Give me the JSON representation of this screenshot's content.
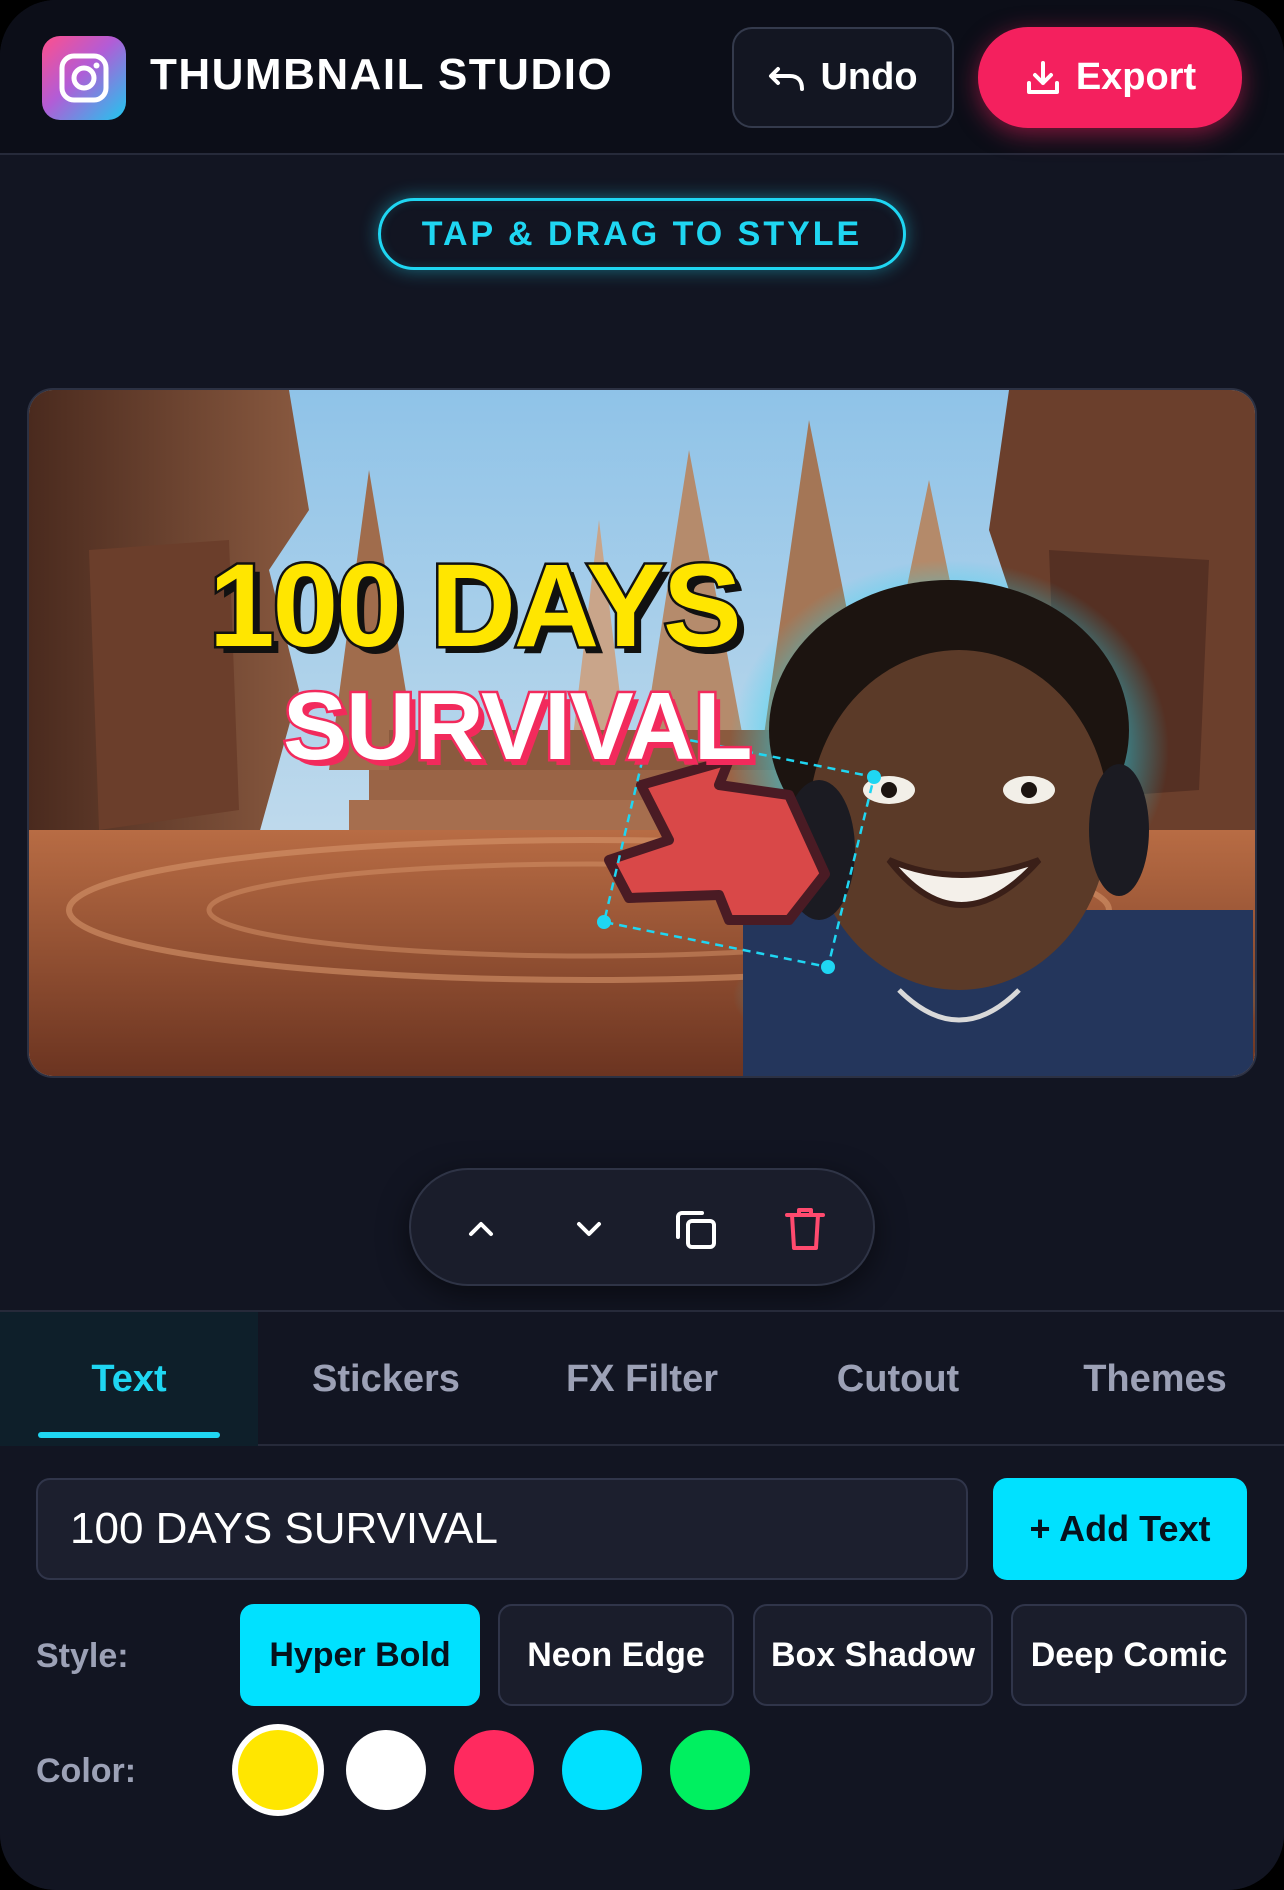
{
  "header": {
    "app_icon": "camera-icon",
    "title": "THUMBNAIL STUDIO",
    "undo_label": "Undo",
    "export_label": "Export"
  },
  "hint": {
    "label": "TAP & DRAG TO STYLE"
  },
  "canvas": {
    "headline": "100 DAYS",
    "headline_color": "#ffe600",
    "subline": "SURVIVAL",
    "subline_outline_color": "#f22a5c",
    "sticker": "arrow-sticker",
    "background": "canyon-arena",
    "cutout": "excited-person-with-headphones"
  },
  "layer_toolbar": {
    "buttons": [
      "chevron-up-icon",
      "chevron-down-icon",
      "duplicate-icon",
      "trash-icon"
    ]
  },
  "tabs": [
    {
      "label": "Text",
      "active": true
    },
    {
      "label": "Stickers",
      "active": false
    },
    {
      "label": "FX Filter",
      "active": false
    },
    {
      "label": "Cutout",
      "active": false
    },
    {
      "label": "Themes",
      "active": false
    }
  ],
  "text_panel": {
    "input_value": "100 DAYS SURVIVAL",
    "add_label": "+ Add Text",
    "style_label": "Style:",
    "styles": [
      {
        "label": "Hyper Bold",
        "active": true
      },
      {
        "label": "Neon Edge",
        "active": false
      },
      {
        "label": "Box Shadow",
        "active": false
      },
      {
        "label": "Deep Comic",
        "active": false
      }
    ],
    "color_label": "Color:",
    "colors": [
      {
        "hex": "#ffe600",
        "selected": true
      },
      {
        "hex": "#ffffff",
        "selected": false
      },
      {
        "hex": "#ff2a5f",
        "selected": false
      },
      {
        "hex": "#00e1ff",
        "selected": false
      },
      {
        "hex": "#00f060",
        "selected": false
      }
    ]
  },
  "theme": {
    "accent": "#00e1ff",
    "danger": "#f4205e",
    "background": "#121522"
  }
}
